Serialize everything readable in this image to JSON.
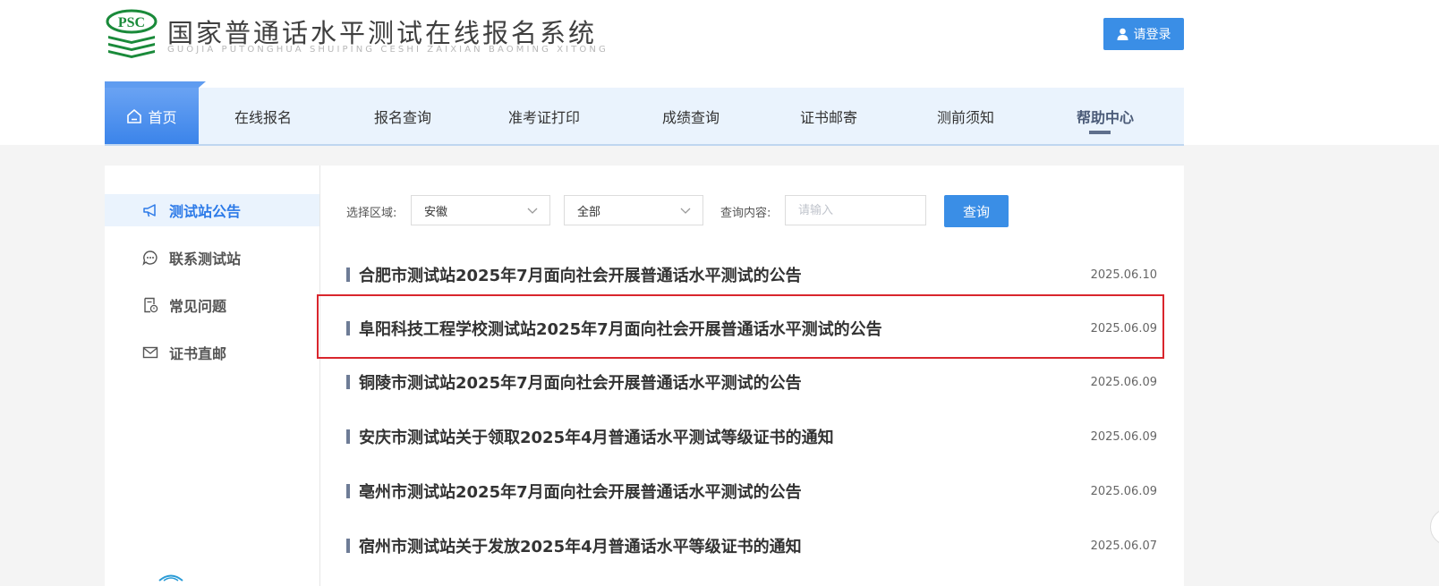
{
  "header": {
    "logo_text": "PSC",
    "title": "国家普通话水平测试在线报名系统",
    "subtitle": "GUOJIA PUTONGHUA SHUIPING CESHI ZAIXIAN BAOMING XITONG",
    "login_label": "请登录"
  },
  "nav": {
    "items": [
      "首页",
      "在线报名",
      "报名查询",
      "准考证打印",
      "成绩查询",
      "证书邮寄",
      "测前须知",
      "帮助中心"
    ]
  },
  "sidebar": {
    "items": [
      {
        "label": "测试站公告",
        "icon": "megaphone-icon"
      },
      {
        "label": "联系测试站",
        "icon": "chat-bubble-icon"
      },
      {
        "label": "常见问题",
        "icon": "question-doc-icon"
      },
      {
        "label": "证书直邮",
        "icon": "mail-icon"
      }
    ]
  },
  "filter": {
    "region_label": "选择区域:",
    "region_value": "安徽",
    "scope_value": "全部",
    "query_label": "查询内容:",
    "query_placeholder": "请输入",
    "query_button": "查询"
  },
  "notices": [
    {
      "title": "合肥市测试站2025年7月面向社会开展普通话水平测试的公告",
      "date": "2025.06.10"
    },
    {
      "title": "阜阳科技工程学校测试站2025年7月面向社会开展普通话水平测试的公告",
      "date": "2025.06.09"
    },
    {
      "title": "铜陵市测试站2025年7月面向社会开展普通话水平测试的公告",
      "date": "2025.06.09"
    },
    {
      "title": "安庆市测试站关于领取2025年4月普通话水平测试等级证书的通知",
      "date": "2025.06.09"
    },
    {
      "title": "亳州市测试站2025年7月面向社会开展普通话水平测试的公告",
      "date": "2025.06.09"
    },
    {
      "title": "宿州市测试站关于发放2025年4月普通话水平等级证书的通知",
      "date": "2025.06.07"
    }
  ],
  "colors": {
    "accent": "#3a8ee6",
    "highlight_border": "#d9262d",
    "logo_green": "#1a8a3a"
  }
}
